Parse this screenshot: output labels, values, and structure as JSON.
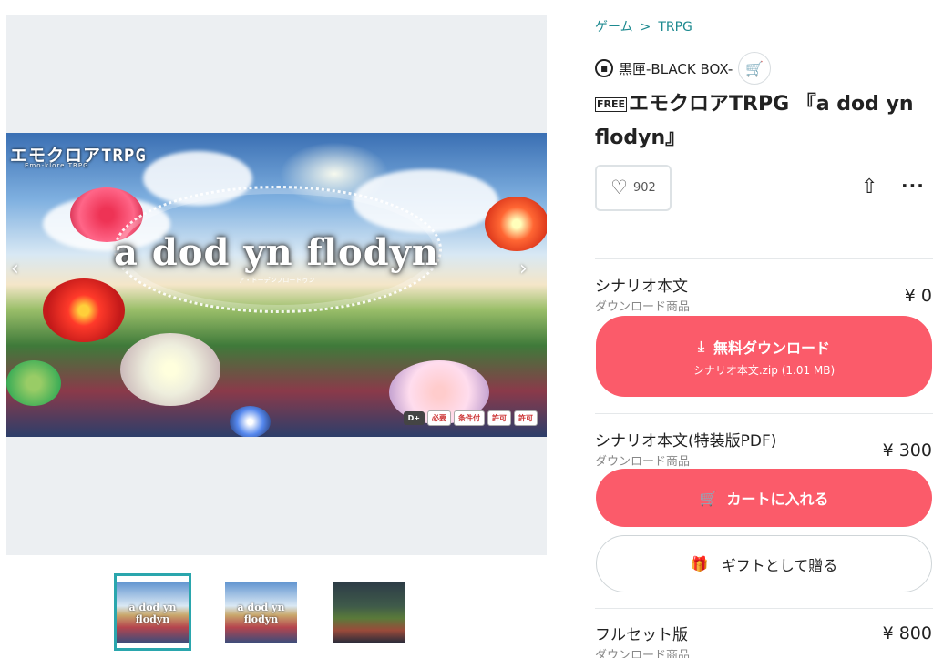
{
  "gallery": {
    "logo": "エモクロアTRPG",
    "logo_sub": "Emo-klore TRPG",
    "title": "a dod yn flodyn",
    "subtitle": "ア・ドーデンフロードゥン",
    "badges": [
      "D+",
      "必要",
      "条件付",
      "許可",
      "許可"
    ],
    "prev_icon": "chevron-left",
    "next_icon": "chevron-right",
    "thumbnails": [
      {
        "caption": "a dod yn flodyn",
        "active": true
      },
      {
        "caption": "a dod yn flodyn",
        "active": false
      },
      {
        "caption": "",
        "active": false
      }
    ]
  },
  "breadcrumb": {
    "category": "ゲーム",
    "separator": ">",
    "subcategory": "TRPG"
  },
  "shop": {
    "name": "黒匣-BLACK BOX-",
    "icon": "shop-icon"
  },
  "product": {
    "free_tag": "FREE",
    "title": "エモクロアTRPG 『a dod yn flodyn』"
  },
  "likes": {
    "count": "902"
  },
  "items": [
    {
      "name": "シナリオ本文",
      "type": "ダウンロード商品",
      "price": "¥ 0",
      "button_label": "無料ダウンロード",
      "button_sub": "シナリオ本文.zip (1.01 MB)"
    },
    {
      "name": "シナリオ本文(特装版PDF)",
      "type": "ダウンロード商品",
      "price": "¥ 300",
      "button_label": "カートに入れる",
      "gift_label": "ギフトとして贈る"
    },
    {
      "name": "フルセット版",
      "type": "ダウンロード商品",
      "price": "¥ 800"
    }
  ],
  "colors": {
    "accent": "#1e8a90",
    "button": "#fb5b6a",
    "thumb_active": "#2aa6ad"
  }
}
